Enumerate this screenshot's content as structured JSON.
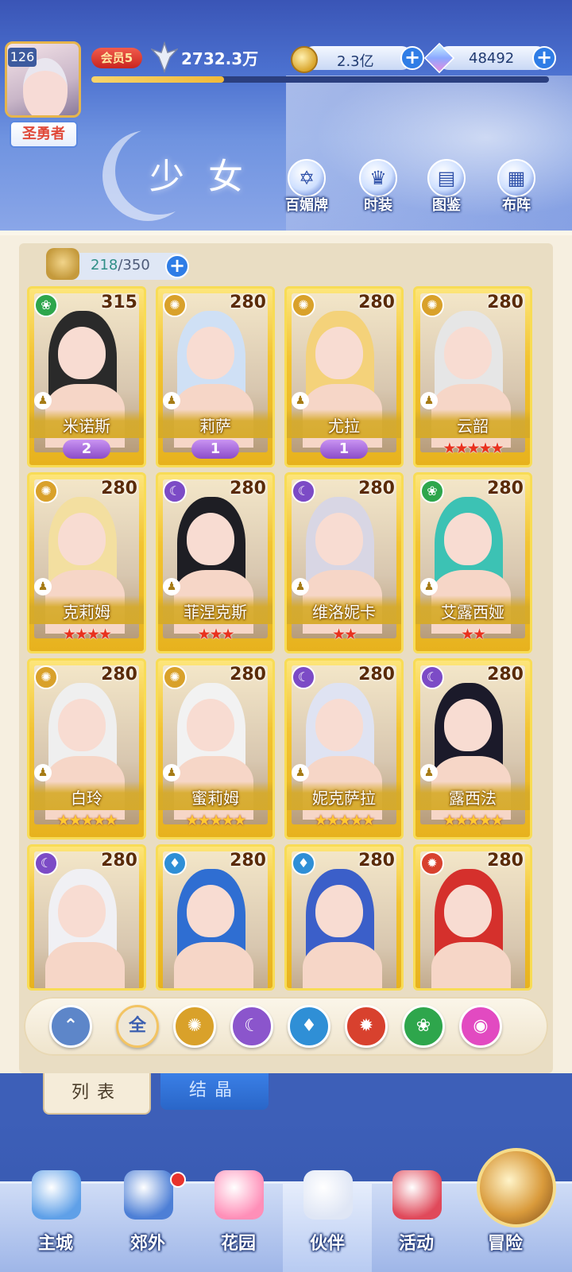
{
  "header": {
    "level": "126",
    "title_badge": "圣勇者",
    "vip": "会员5",
    "power": "2732.3万",
    "exp_fraction": 0.29,
    "gold": "2.3亿",
    "gems": "48492",
    "page_title": "少女",
    "buttons": [
      {
        "label": "百媚牌",
        "icon": "card-icon"
      },
      {
        "label": "时装",
        "icon": "outfit-icon"
      },
      {
        "label": "图鉴",
        "icon": "book-icon"
      },
      {
        "label": "布阵",
        "icon": "grid-icon"
      }
    ]
  },
  "roster": {
    "current": "218",
    "max": "/350"
  },
  "cards": [
    {
      "name": "米诺斯",
      "level": "315",
      "element": "wind",
      "rank": "2",
      "stars": "",
      "hair": "#2a2a2a"
    },
    {
      "name": "莉萨",
      "level": "280",
      "element": "light",
      "rank": "1",
      "stars": "",
      "hair": "#cfe0f5"
    },
    {
      "name": "尤拉",
      "level": "280",
      "element": "light",
      "rank": "1",
      "stars": "",
      "hair": "#f4d27a"
    },
    {
      "name": "云韶",
      "level": "280",
      "element": "light",
      "rank": "",
      "stars": "★★★★★",
      "star_color": "red",
      "hair": "#e6e6e6"
    },
    {
      "name": "克莉姆",
      "level": "280",
      "element": "light",
      "rank": "",
      "stars": "★★★★",
      "star_color": "red",
      "hair": "#f3dfa0"
    },
    {
      "name": "菲涅克斯",
      "level": "280",
      "element": "dark",
      "rank": "",
      "stars": "★★★",
      "star_color": "red",
      "hair": "#1e1e24"
    },
    {
      "name": "维洛妮卡",
      "level": "280",
      "element": "dark",
      "rank": "",
      "stars": "★★",
      "star_color": "red",
      "hair": "#d8d6e4"
    },
    {
      "name": "艾露西娅",
      "level": "280",
      "element": "wind",
      "rank": "",
      "stars": "★★",
      "star_color": "red",
      "hair": "#3cc2b4"
    },
    {
      "name": "白玲",
      "level": "280",
      "element": "light",
      "rank": "",
      "stars": "★★★★★",
      "star_color": "gold",
      "hair": "#efefef"
    },
    {
      "name": "蜜莉姆",
      "level": "280",
      "element": "light",
      "rank": "",
      "stars": "★★★★★",
      "star_color": "gold",
      "hair": "#f2f2f2"
    },
    {
      "name": "妮克萨拉",
      "level": "280",
      "element": "dark",
      "rank": "",
      "stars": "★★★★★",
      "star_color": "gold",
      "hair": "#dfe3f2"
    },
    {
      "name": "露西法",
      "level": "280",
      "element": "dark",
      "rank": "",
      "stars": "★★★★★",
      "star_color": "gold",
      "hair": "#1b1a2a"
    },
    {
      "name": "",
      "level": "280",
      "element": "dark",
      "rank": "",
      "stars": "",
      "hair": "#f0f0f4"
    },
    {
      "name": "",
      "level": "280",
      "element": "water",
      "rank": "",
      "stars": "",
      "hair": "#2f6ed2"
    },
    {
      "name": "",
      "level": "280",
      "element": "water",
      "rank": "",
      "stars": "",
      "hair": "#3b5fc9"
    },
    {
      "name": "",
      "level": "280",
      "element": "fire",
      "rank": "",
      "stars": "",
      "hair": "#d5302c"
    }
  ],
  "element_colors": {
    "wind": "#2ea64c",
    "light": "#d9a12a",
    "dark": "#7c4bc6",
    "water": "#2f8fd6",
    "fire": "#d8412e"
  },
  "filters": [
    {
      "label": "",
      "icon": "collapse-up-icon",
      "color": "#5d86c9"
    },
    {
      "label": "全",
      "icon": "all-icon",
      "color": "#efe7d6"
    },
    {
      "label": "",
      "icon": "light-element-icon",
      "color": "#d9a12a"
    },
    {
      "label": "",
      "icon": "dark-element-icon",
      "color": "#8b55cc"
    },
    {
      "label": "",
      "icon": "water-element-icon",
      "color": "#2f8fd6"
    },
    {
      "label": "",
      "icon": "fire-element-icon",
      "color": "#d8412e"
    },
    {
      "label": "",
      "icon": "wind-element-icon",
      "color": "#2ea64c"
    },
    {
      "label": "",
      "icon": "special-element-icon",
      "color": "#e24ac1"
    }
  ],
  "tabs": {
    "list": "列表",
    "crystal": "结晶"
  },
  "nav": [
    {
      "label": "主城",
      "icon": "castle-icon"
    },
    {
      "label": "郊外",
      "icon": "portal-icon"
    },
    {
      "label": "花园",
      "icon": "heart-icon"
    },
    {
      "label": "伙伴",
      "icon": "partner-icon"
    },
    {
      "label": "活动",
      "icon": "gift-icon"
    },
    {
      "label": "冒险",
      "icon": "adventure-icon"
    }
  ]
}
